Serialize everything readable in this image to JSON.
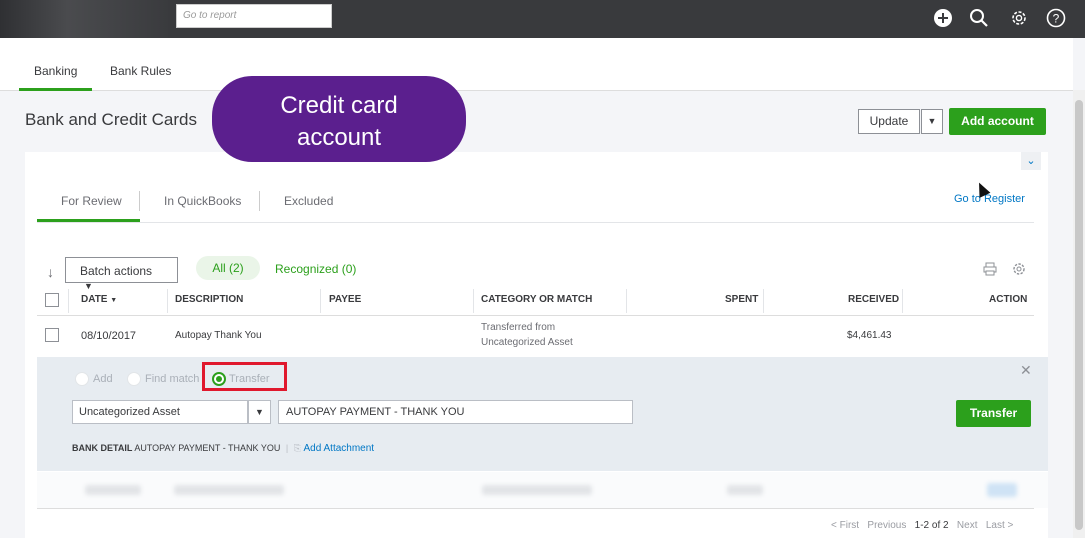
{
  "topbar": {
    "search_placeholder": "Go to report",
    "icons": [
      "plus-circle-icon",
      "search-icon",
      "gear-icon",
      "help-icon"
    ]
  },
  "main_tabs": [
    {
      "label": "Banking",
      "active": true
    },
    {
      "label": "Bank Rules",
      "active": false
    }
  ],
  "page": {
    "title": "Bank and Credit Cards",
    "callout_line1": "Credit card",
    "callout_line2": "account",
    "update_label": "Update",
    "add_account_label": "Add account"
  },
  "subtabs": [
    {
      "label": "For Review",
      "active": true
    },
    {
      "label": "In QuickBooks",
      "active": false
    },
    {
      "label": "Excluded",
      "active": false
    }
  ],
  "go_to_register": "Go to Register",
  "toolbar": {
    "batch_actions": "Batch actions",
    "filter_all": "All (2)",
    "filter_recognized": "Recognized (0)"
  },
  "table": {
    "headers": {
      "date": "DATE",
      "description": "DESCRIPTION",
      "payee": "PAYEE",
      "category": "CATEGORY OR MATCH",
      "spent": "SPENT",
      "received": "RECEIVED",
      "action": "ACTION"
    },
    "rows": [
      {
        "date": "08/10/2017",
        "description": "Autopay Thank You",
        "payee": "",
        "category_line1": "Transferred from",
        "category_line2": "Uncategorized Asset",
        "spent": "",
        "received": "$4,461.43"
      }
    ]
  },
  "detail": {
    "radio_add": "Add",
    "radio_find_match": "Find match",
    "radio_transfer": "Transfer",
    "selected": "Transfer",
    "account_select": "Uncategorized Asset",
    "memo_value": "AUTOPAY PAYMENT - THANK YOU",
    "transfer_button": "Transfer",
    "bank_detail_label": "BANK DETAIL",
    "bank_detail_value": "AUTOPAY PAYMENT - THANK YOU",
    "add_attachment": "Add Attachment"
  },
  "pager": {
    "first": "< First",
    "previous": "Previous",
    "range": "1-2 of 2",
    "next": "Next",
    "last": "Last >"
  },
  "colors": {
    "brand_green": "#2ca01c",
    "link_blue": "#0077c5",
    "callout_purple": "#5b1f8e",
    "highlight_red": "#e0182d",
    "topbar": "#393a3d"
  }
}
